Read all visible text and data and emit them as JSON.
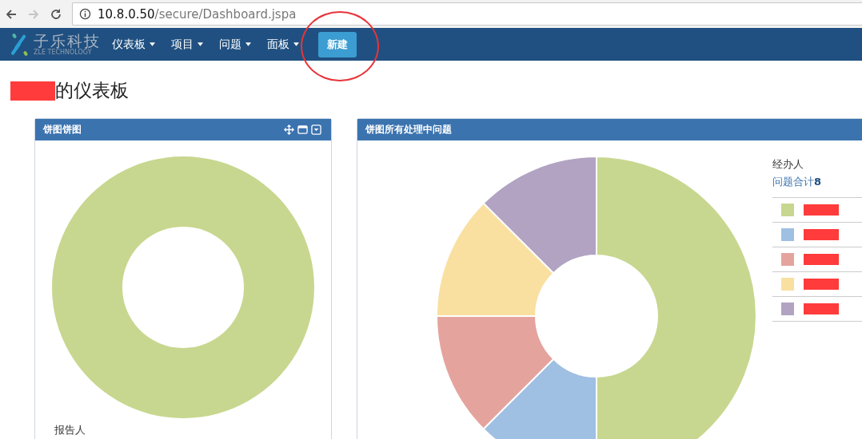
{
  "browser": {
    "url_host": "10.8.0.50",
    "url_path": "/secure/Dashboard.jspa",
    "forward_disabled": true
  },
  "header": {
    "logo_name": "子乐科技",
    "logo_sub": "ZLE TECHNOLOGY",
    "menus": [
      {
        "label": "仪表板"
      },
      {
        "label": "项目"
      },
      {
        "label": "问题"
      },
      {
        "label": "面板"
      }
    ],
    "create_button": "新建",
    "create_highlighted": true
  },
  "page_title": "的仪表板",
  "gadgets": [
    {
      "title": "饼图饼图",
      "controls": true,
      "chart_label": "报告人"
    },
    {
      "title": "饼图所有处理中问题",
      "controls": false,
      "legend": {
        "title": "经办人",
        "total_label": "问题合计",
        "total": "8",
        "items": [
          {
            "color": "#c7d78f"
          },
          {
            "color": "#9fbfe3"
          },
          {
            "color": "#e5a39d"
          },
          {
            "color": "#f9e0a0"
          },
          {
            "color": "#b1a3c1"
          }
        ]
      }
    }
  ]
}
